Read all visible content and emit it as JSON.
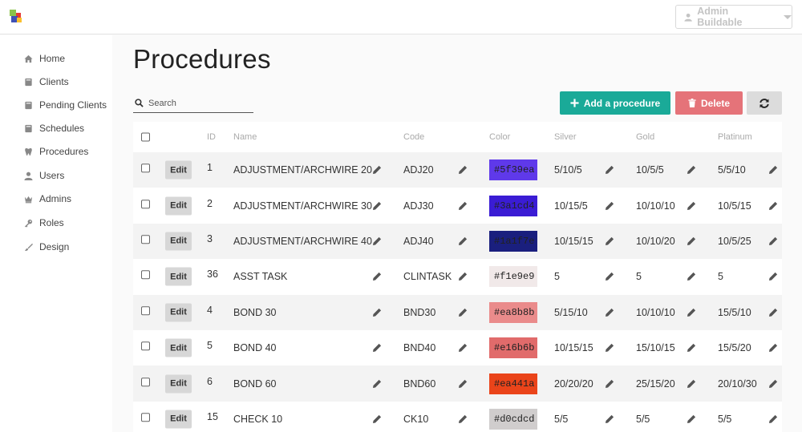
{
  "header": {
    "user_label": "Admin Buildable"
  },
  "sidebar": {
    "items": [
      {
        "label": "Home",
        "icon": "home-icon"
      },
      {
        "label": "Clients",
        "icon": "book-icon"
      },
      {
        "label": "Pending Clients",
        "icon": "book-icon"
      },
      {
        "label": "Schedules",
        "icon": "book-icon"
      },
      {
        "label": "Procedures",
        "icon": "tooth-icon"
      },
      {
        "label": "Users",
        "icon": "user-icon"
      },
      {
        "label": "Admins",
        "icon": "crown-icon"
      },
      {
        "label": "Roles",
        "icon": "key-icon"
      },
      {
        "label": "Design",
        "icon": "brush-icon"
      }
    ]
  },
  "page": {
    "title": "Procedures",
    "search_placeholder": "Search",
    "add_label": "Add a procedure",
    "delete_label": "Delete"
  },
  "table": {
    "columns": {
      "id": "ID",
      "name": "Name",
      "code": "Code",
      "color": "Color",
      "silver": "Silver",
      "gold": "Gold",
      "platinum": "Platinum"
    },
    "edit_label": "Edit",
    "rows": [
      {
        "id": "1",
        "name": "ADJUSTMENT/ARCHWIRE 20",
        "code": "ADJ20",
        "color": "#5f39ea",
        "silver": "5/10/5",
        "gold": "10/5/5",
        "platinum": "5/5/10"
      },
      {
        "id": "2",
        "name": "ADJUSTMENT/ARCHWIRE 30",
        "code": "ADJ30",
        "color": "#3a1cd4",
        "silver": "10/15/5",
        "gold": "10/10/10",
        "platinum": "10/5/15"
      },
      {
        "id": "3",
        "name": "ADJUSTMENT/ARCHWIRE 40",
        "code": "ADJ40",
        "color": "#1a1f7e",
        "silver": "10/15/15",
        "gold": "10/10/20",
        "platinum": "10/5/25"
      },
      {
        "id": "36",
        "name": "ASST TASK",
        "code": "CLINTASK",
        "color": "#f1e9e9",
        "silver": "5",
        "gold": "5",
        "platinum": "5"
      },
      {
        "id": "4",
        "name": "BOND 30",
        "code": "BND30",
        "color": "#ea8b8b",
        "silver": "5/15/10",
        "gold": "10/10/10",
        "platinum": "15/5/10"
      },
      {
        "id": "5",
        "name": "BOND 40",
        "code": "BND40",
        "color": "#e16b6b",
        "silver": "10/15/15",
        "gold": "15/10/15",
        "platinum": "15/5/20"
      },
      {
        "id": "6",
        "name": "BOND 60",
        "code": "BND60",
        "color": "#ea441a",
        "silver": "20/20/20",
        "gold": "25/15/20",
        "platinum": "20/10/30"
      },
      {
        "id": "15",
        "name": "CHECK 10",
        "code": "CK10",
        "color": "#d0cdcd",
        "silver": "5/5",
        "gold": "5/5",
        "platinum": "5/5"
      }
    ]
  }
}
